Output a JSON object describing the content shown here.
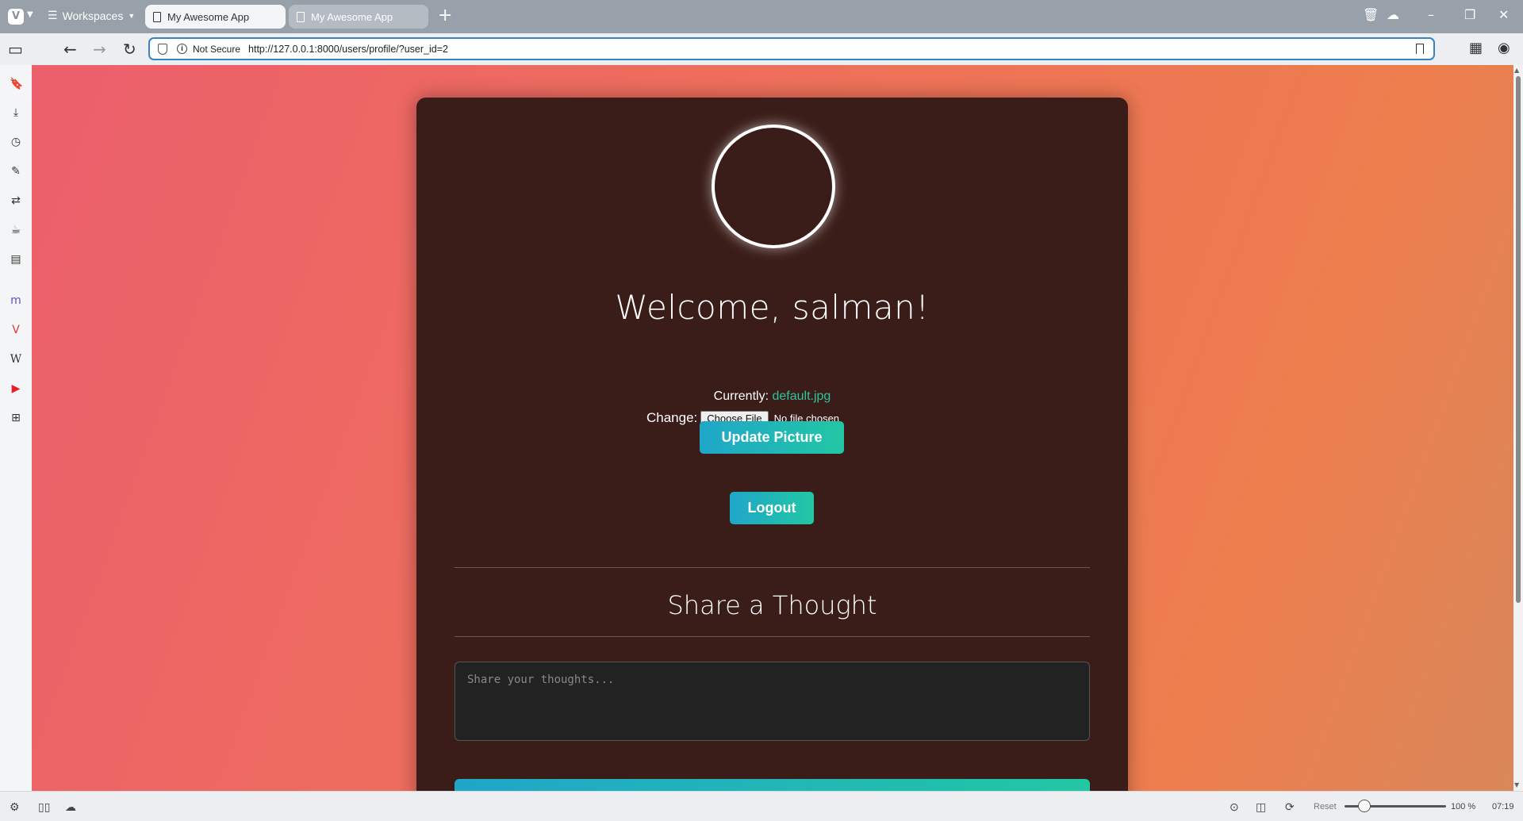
{
  "browser": {
    "workspaces_label": "Workspaces",
    "tabs": [
      {
        "title": "My Awesome App"
      },
      {
        "title": "My Awesome App"
      }
    ],
    "security_label": "Not Secure",
    "url": "http://127.0.0.1:8000/users/profile/?user_id=2",
    "zoom_reset_label": "Reset",
    "zoom_level": "100 %",
    "time": "07:19"
  },
  "profile": {
    "welcome": "Welcome, salman!",
    "currently_label": "Currently:",
    "current_file": "default.jpg",
    "change_label": "Change:",
    "choose_file_label": "Choose File",
    "no_file_label": "No file chosen",
    "update_button": "Update Picture",
    "logout_button": "Logout"
  },
  "thought": {
    "heading": "Share a Thought",
    "placeholder": "Share your thoughts..."
  },
  "colors": {
    "accent_start": "#1fa6c9",
    "accent_end": "#22c7a4",
    "card_bg": "#3a1c18",
    "link": "#2ec4a0"
  }
}
